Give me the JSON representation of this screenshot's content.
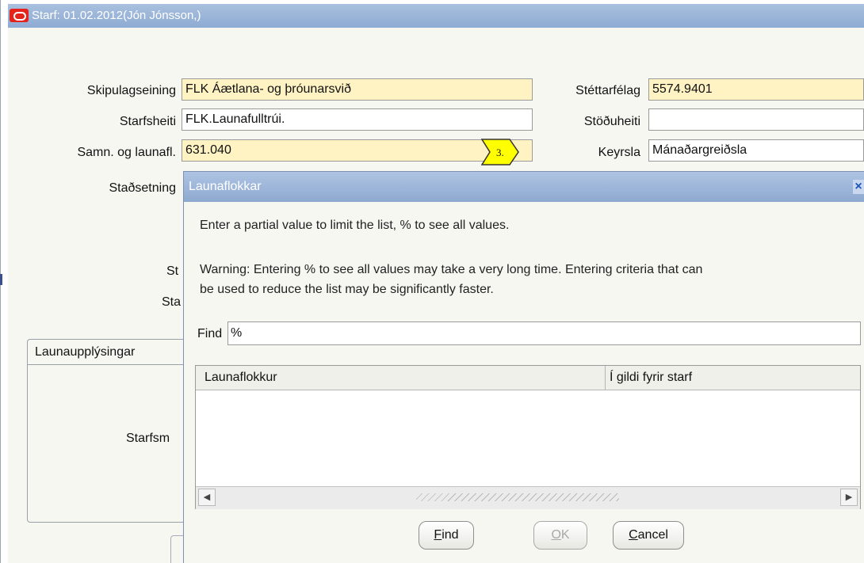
{
  "window": {
    "title": "Starf: 01.02.2012(Jón Jónsson,)"
  },
  "form": {
    "skipulagseining_label": "Skipulagseining",
    "skipulagseining_value": "FLK Áætlana- og þróunarsvið",
    "starfsheiti_label": "Starfsheiti",
    "starfsheiti_value": "FLK.Launafulltrúi.",
    "samn_label": "Samn. og launafl.",
    "samn_value": "631.040",
    "stadsetning_label": "Staðsetning",
    "stettarfelag_label": "Stéttarfélag",
    "stettarfelag_value": "5574.9401",
    "stoduheiti_label": "Stöðuheiti",
    "stoduheiti_value": "",
    "keyrsla_label": "Keyrsla",
    "keyrsla_value": "Mánaðargreiðsla",
    "partial_label_1": "St",
    "partial_label_2": "Sta",
    "partial_label_3": "Starfsm"
  },
  "marker": {
    "text": "3.",
    "color": "#ffff00"
  },
  "tab": {
    "label": "Launaupplýsingar"
  },
  "dialog": {
    "title": "Launaflokkar",
    "instruction": "Enter a partial value to limit the list, % to see all values.",
    "warning_line1": "Warning: Entering % to see all values may take a very long time. Entering criteria that can",
    "warning_line2": "be used to reduce the list may be significantly faster.",
    "find_label": "Find",
    "find_value": "%",
    "columns": [
      "Launaflokkur",
      "Í gildi fyrir starf"
    ],
    "rows": [],
    "buttons": {
      "find_prefix": "",
      "find_accel": "F",
      "find_rest": "ind",
      "ok_accel": "O",
      "ok_rest": "K",
      "cancel_accel": "C",
      "cancel_rest": "ancel"
    }
  },
  "colors": {
    "required_field": "#fff3c4",
    "titlebar": "#a9c0de",
    "oracle_red": "#e5231b"
  }
}
